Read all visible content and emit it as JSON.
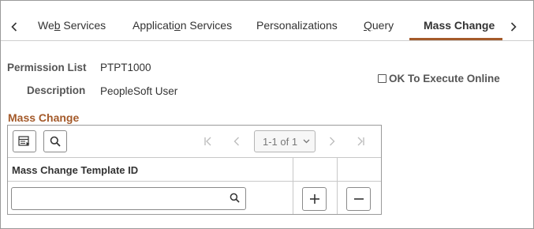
{
  "tabs": [
    {
      "pre": "We",
      "ul": "b",
      "post": " Services"
    },
    {
      "pre": "Applicati",
      "ul": "o",
      "post": "n Services"
    },
    {
      "pre": "Personalizations",
      "ul": "",
      "post": ""
    },
    {
      "pre": "",
      "ul": "Q",
      "post": "uery"
    },
    {
      "pre": "Mass Change",
      "ul": "",
      "post": ""
    }
  ],
  "active_tab": "Mass Change",
  "fields": {
    "permission_list_label": "Permission List",
    "permission_list_value": "PTPT1000",
    "description_label": "Description",
    "description_value": "PeopleSoft User",
    "ok_execute_label": "OK To Execute Online",
    "ok_execute_checked": false
  },
  "grid": {
    "section_title": "Mass Change",
    "pager_text": "1-1 of 1",
    "column_header": "Mass Change Template ID",
    "search_value": ""
  },
  "colors": {
    "accent": "#a45a2a",
    "border": "#9a9a9a",
    "disabled": "#bdbdbd"
  }
}
